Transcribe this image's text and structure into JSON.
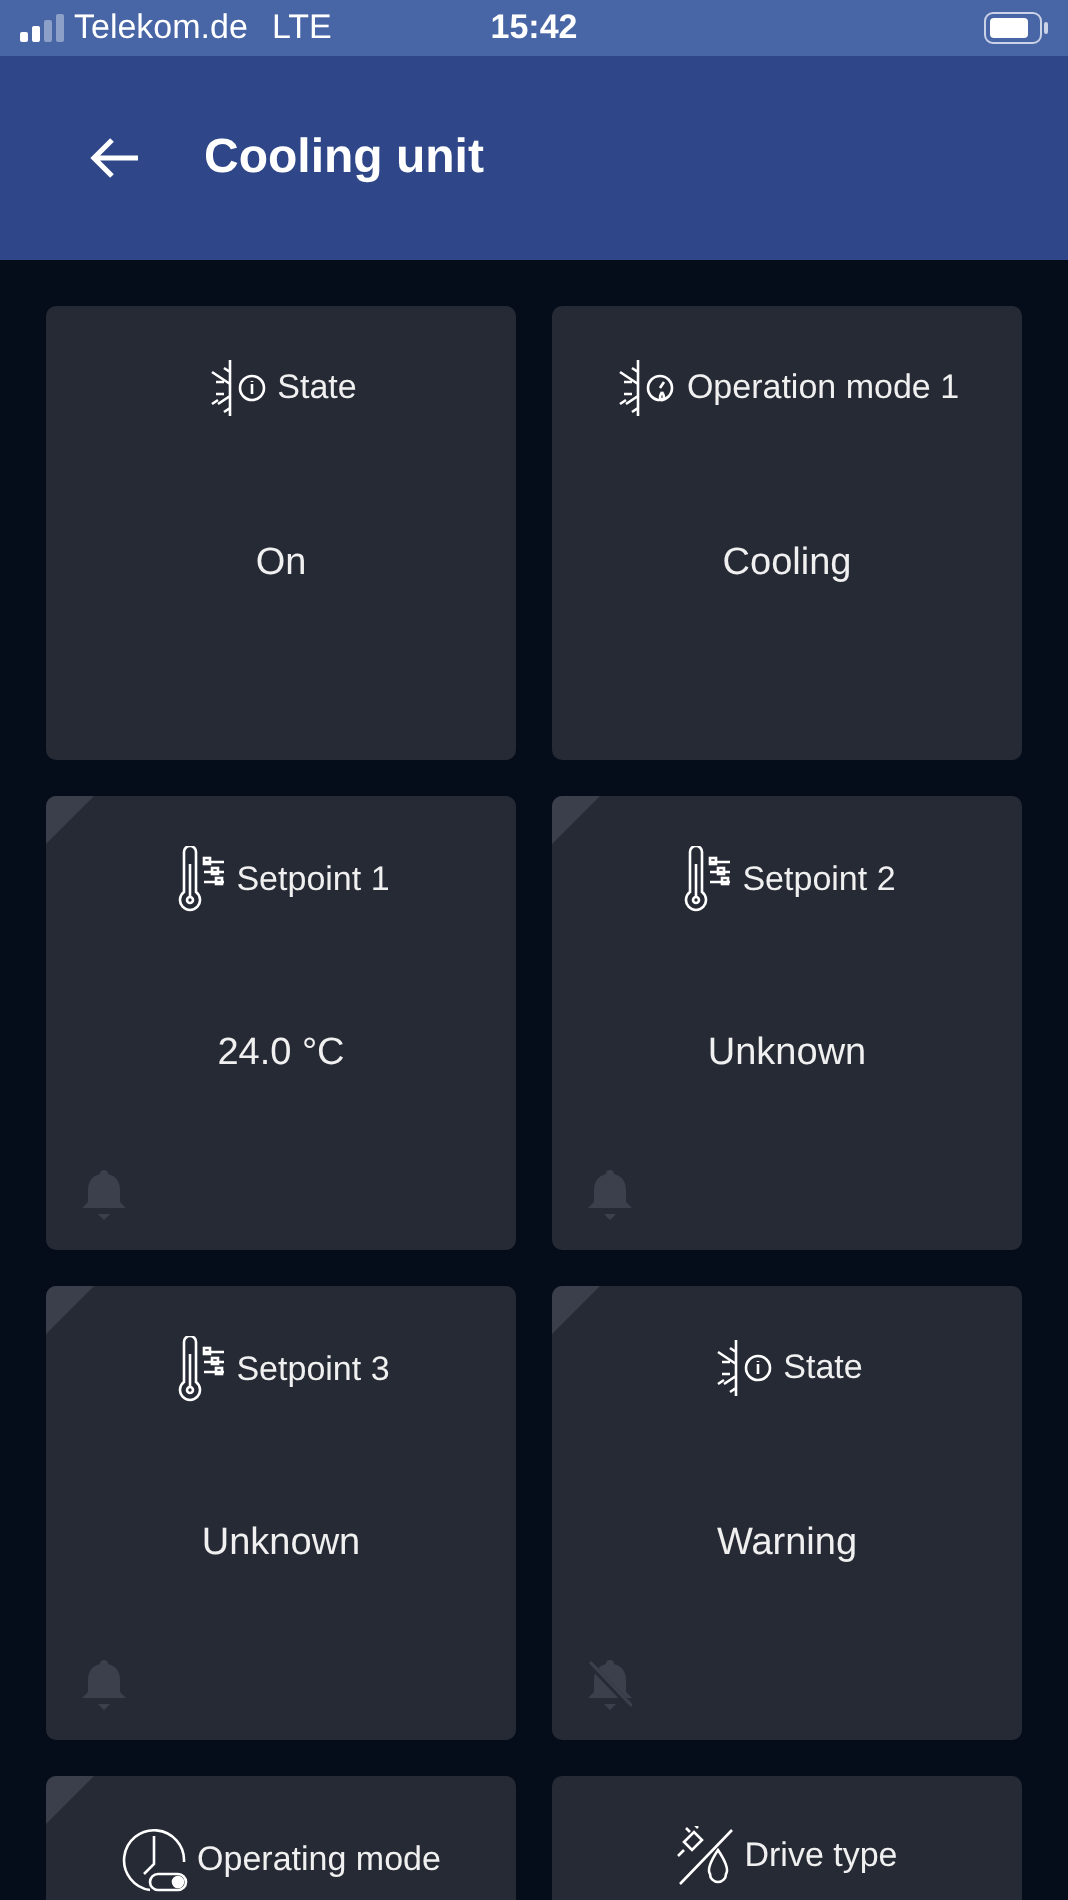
{
  "status_bar": {
    "carrier": "Telekom.de",
    "network": "LTE",
    "time": "15:42"
  },
  "header": {
    "title": "Cooling unit"
  },
  "cards": [
    {
      "kind": "status",
      "title": "State",
      "value": "On",
      "corner": false,
      "alarm": false
    },
    {
      "kind": "mode",
      "title": "Operation mode 1",
      "value": "Cooling",
      "corner": false,
      "alarm": false
    },
    {
      "kind": "setpoint",
      "title": "Setpoint 1",
      "value": "24.0 °C",
      "corner": true,
      "alarm": true,
      "muted": false
    },
    {
      "kind": "setpoint",
      "title": "Setpoint 2",
      "value": "Unknown",
      "corner": true,
      "alarm": true,
      "muted": false
    },
    {
      "kind": "setpoint",
      "title": "Setpoint 3",
      "value": "Unknown",
      "corner": true,
      "alarm": true,
      "muted": false
    },
    {
      "kind": "status",
      "title": "State",
      "value": "Warning",
      "corner": true,
      "alarm": true,
      "muted": true
    },
    {
      "kind": "schedule",
      "title": "Operating mode",
      "corner": true
    },
    {
      "kind": "drive",
      "title": "Drive type",
      "corner": false
    }
  ]
}
